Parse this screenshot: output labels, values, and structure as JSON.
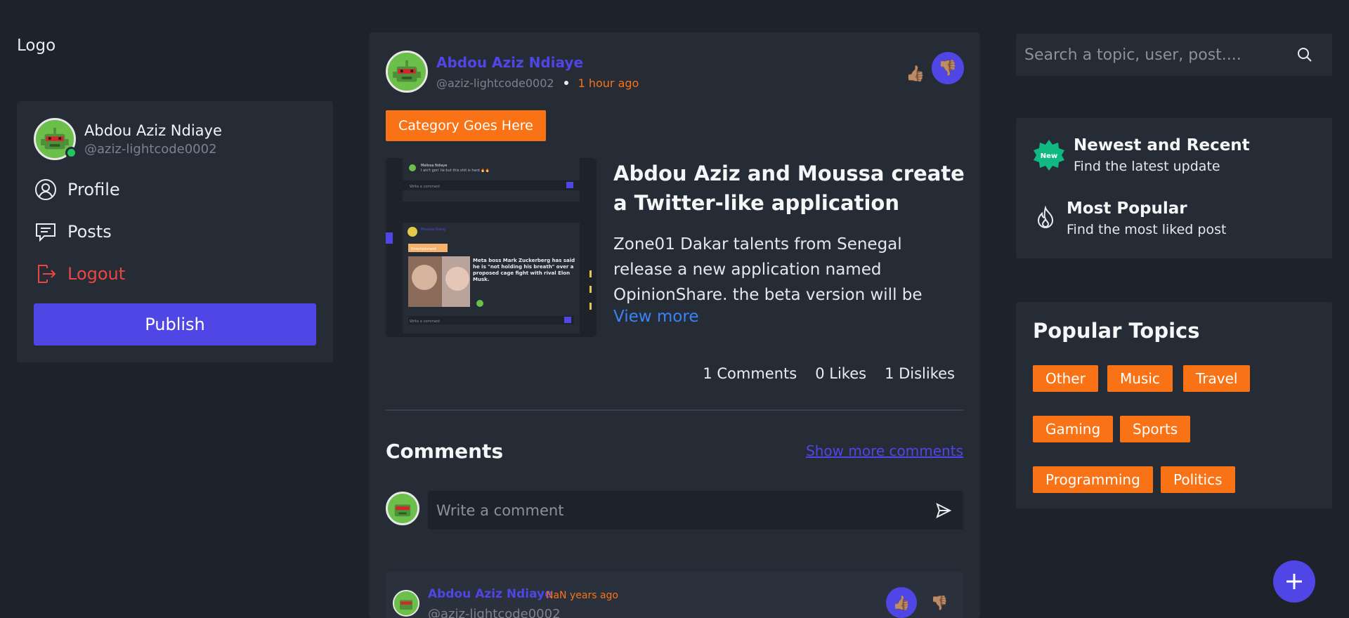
{
  "logo": "Logo",
  "user": {
    "name": "Abdou Aziz Ndiaye",
    "handle": "@aziz-lightcode0002"
  },
  "nav": {
    "profile": "Profile",
    "posts": "Posts",
    "logout": "Logout",
    "publish": "Publish"
  },
  "post": {
    "author": "Abdou Aziz Ndiaye",
    "handle": "@aziz-lightcode0002",
    "time": "1 hour ago",
    "category": "Category Goes Here",
    "title": "Abdou Aziz and Moussa create a Twitter-like application",
    "body": "Zone01 Dakar talents from Senegal release a new application named OpinionShare. the beta version will be",
    "view_more": "View more",
    "stats": {
      "comments": "1 Comments",
      "likes": "0 Likes",
      "dislikes": "1 Dislikes"
    },
    "image": {
      "comment_placeholder": "Write a comment",
      "inner_name_1": "Melissa Ndiaye",
      "inner_text_1": "I ain't gon' lie but this shit is hard 🔥🔥",
      "inner_author": "Moussa Dieng",
      "inner_category": "Entertainment",
      "inner_headline": "Meta boss Mark Zuckerberg has said he is \"not holding his breath\" over a proposed cage fight with rival Elon Musk."
    }
  },
  "comments": {
    "title": "Comments",
    "show_more": "Show more comments",
    "placeholder": "Write a comment",
    "items": [
      {
        "author": "Abdou Aziz Ndiaye",
        "time": "NaN years ago",
        "handle": "@aziz-lightcode0002"
      }
    ]
  },
  "search": {
    "placeholder": "Search a topic, user, post...."
  },
  "filters": {
    "new_badge": "New",
    "newest_title": "Newest and Recent",
    "newest_sub": "Find the latest update",
    "popular_title": "Most Popular",
    "popular_sub": "Find the most liked post"
  },
  "topics": {
    "title": "Popular Topics",
    "tags": [
      "Other",
      "Music",
      "Travel",
      "Gaming",
      "Sports",
      "Programming",
      "Politics"
    ]
  },
  "colors": {
    "accent": "#4f46e5",
    "orange": "#f97316",
    "danger": "#ef4444",
    "link": "#3b82f6",
    "background": "#1d222b",
    "card": "#262c36"
  },
  "icons": {
    "profile": "user-circle-icon",
    "posts": "message-icon",
    "logout": "logout-icon",
    "like": "thumbs-up-icon",
    "dislike": "thumbs-down-icon",
    "send": "send-icon",
    "search": "search-icon",
    "new": "new-badge-icon",
    "popular": "flame-icon",
    "fab": "plus-icon"
  }
}
